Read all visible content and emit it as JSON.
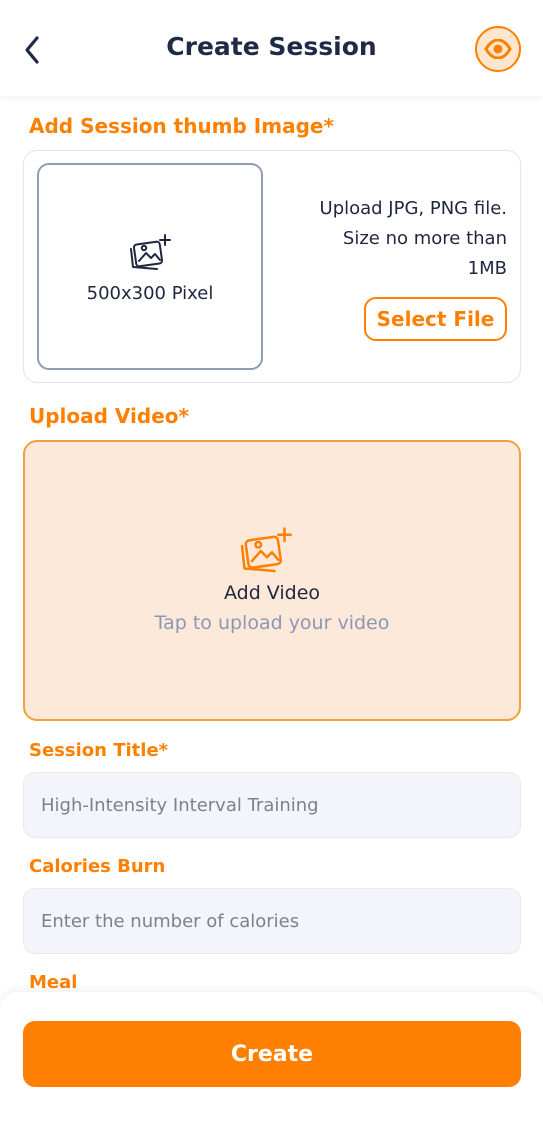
{
  "header": {
    "title": "Create Session",
    "back_icon": "chevron-left-icon",
    "preview_icon": "eye-icon"
  },
  "thumbnail": {
    "label": "Add Session thumb Image*",
    "box_text": "500x300 Pixel",
    "icon": "image-add-icon",
    "info_line1": "Upload JPG, PNG file.",
    "info_line2": "Size no more than",
    "info_line3": "1MB",
    "select_label": "Select File"
  },
  "video": {
    "label": "Upload Video*",
    "icon": "image-add-icon",
    "title": "Add Video",
    "subtitle": "Tap to upload your video"
  },
  "session_title": {
    "label": "Session Title*",
    "placeholder": "High-Intensity Interval Training"
  },
  "calories": {
    "label": "Calories Burn",
    "placeholder": "Enter the number of calories"
  },
  "meal": {
    "label": "Meal"
  },
  "footer": {
    "create_label": "Create"
  },
  "colors": {
    "accent": "#ff8000",
    "text_dark": "#1f2a44",
    "muted": "#8b98b4",
    "video_bg": "#fde9d9",
    "input_bg": "#f3f5fb"
  }
}
